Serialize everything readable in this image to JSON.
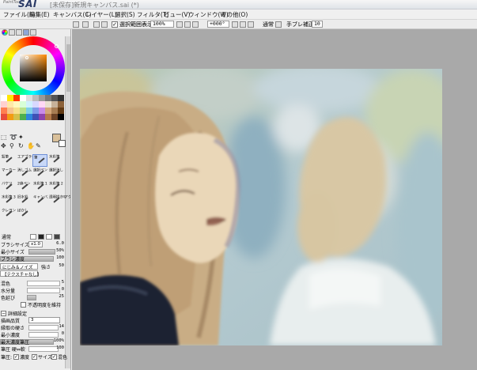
{
  "app": {
    "logo_small": "PaintTool",
    "logo_big": "SAI",
    "window_title": "[未保存]新規キャンバス.sai (*)"
  },
  "menu": [
    "ファイル(F)",
    "編集(E)",
    "キャンバス(C)",
    "レイヤー(L)",
    "選択(S)",
    "フィルタ(T)",
    "ビュー(V)",
    "ウィンドウ(W)",
    "その他(O)"
  ],
  "toolbar": {
    "selection_display": "選択範囲表示",
    "zoom": "100%",
    "angle": "+000°",
    "blend_mode": "通常",
    "stabilizer_label": "手ブレ補正",
    "stabilizer_value": "10"
  },
  "palette": {
    "fg_color": "#d9c09a",
    "bg_color": "#ffffff",
    "swatches": [
      "#ffffff",
      "#ffe600",
      "#ff3a00",
      "#ffffff",
      "#dddddd",
      "#bbbbbb",
      "#999999",
      "#777777",
      "#555555",
      "#333333",
      "#ffd0d0",
      "#ffe9a8",
      "#fff9c0",
      "#d8ffd8",
      "#d0f0ff",
      "#d8d8ff",
      "#ffd8f5",
      "#e9e0d0",
      "#c7b299",
      "#8c6239",
      "#ff7f50",
      "#f6c38e",
      "#f7e08c",
      "#b8e28a",
      "#7fd0e8",
      "#7f9be8",
      "#c98be8",
      "#d2a679",
      "#a67c52",
      "#603913",
      "#e84b3c",
      "#f39c12",
      "#d4c04a",
      "#4caf50",
      "#2e86de",
      "#3f51b5",
      "#8e44ad",
      "#b57a4a",
      "#6b4226",
      "#000000"
    ]
  },
  "tools": [
    {
      "label": "鉛筆",
      "selected": false
    },
    {
      "label": "エアブラシ",
      "selected": false
    },
    {
      "label": "筆",
      "selected": true
    },
    {
      "label": "水彩筆",
      "selected": false
    },
    {
      "label": "マーカー",
      "selected": false
    },
    {
      "label": "消しゴム",
      "selected": false
    },
    {
      "label": "選択ペン",
      "selected": false
    },
    {
      "label": "選択消し",
      "selected": false
    },
    {
      "label": "バケツ",
      "selected": false
    },
    {
      "label": "2値ペン",
      "selected": false
    },
    {
      "label": "水彩筆 1",
      "selected": false
    },
    {
      "label": "水彩筆 2",
      "selected": false
    },
    {
      "label": "水彩筆 3",
      "selected": false
    },
    {
      "label": "旧水彩",
      "selected": false
    },
    {
      "label": "キャンバス アクリル",
      "selected": false
    },
    {
      "label": "透明描き アクリル",
      "selected": false
    },
    {
      "label": "クレヨン",
      "selected": false
    },
    {
      "label": "ぼかし",
      "selected": false
    }
  ],
  "brush": {
    "mode": "通常",
    "size_label": "ブラシサイズ",
    "size_mult": "x1.0",
    "size_value": "6.0",
    "min_size_label": "最小サイズ",
    "min_size_value": "50%",
    "density_label": "ブラシ濃度",
    "density_value": "100",
    "texture_dd": "にじみ＆ノイズ",
    "texture_strength_label": "強さ",
    "texture_strength": "50",
    "texture2_dd": "【テクスチャなし】",
    "mix_label": "混色",
    "mix_value": "5",
    "water_label": "水分量",
    "water_value": "0",
    "persist_label": "色延び",
    "persist_value": "25",
    "keep_opacity_label": "不透明度を維持",
    "detail_label": "詳細設定",
    "quality_label": "描画品質",
    "quality_value": "3",
    "edge_label": "縁取の硬さ",
    "edge_value": "14",
    "min_density_label": "最小濃度",
    "min_density_value": "0",
    "max_density_pressure_label": "最大濃度筆圧",
    "max_density_pressure_value": "100%",
    "pressure_hard_label": "筆圧 硬⇔軟",
    "pressure_hard_value": "100",
    "pressure_label": "筆圧:",
    "pressure_density": "濃度",
    "pressure_size": "サイズ",
    "pressure_mix": "混色"
  }
}
